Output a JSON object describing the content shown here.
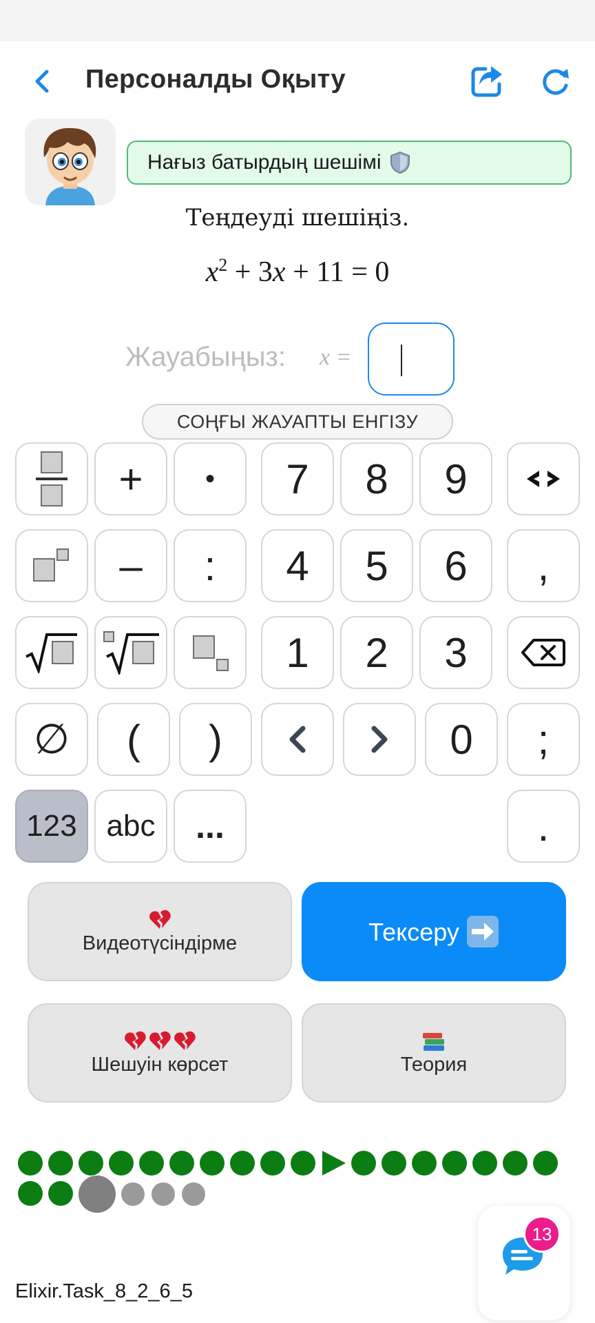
{
  "header": {
    "title": "Персоналды Оқыту",
    "back_icon": "chevron-left-icon",
    "share_icon": "share-icon",
    "refresh_icon": "refresh-icon",
    "accent_color": "#1e88e5"
  },
  "badge": {
    "text": "Нағыз батырдың шешімі",
    "icon": "shield-icon"
  },
  "task": {
    "prompt": "Теңдеуді шешіңіз.",
    "equation": {
      "a": "x",
      "exp": "2",
      "rest": " + 3",
      "b": "x",
      "tail": " + 11 = 0"
    }
  },
  "answer": {
    "label": "Жауабыңыз:",
    "var": "x =",
    "value": ""
  },
  "submit_last_label": "СОҢҒЫ ЖАУАПТЫ ЕНГІЗУ",
  "keypad": {
    "plus": "+",
    "dot": "•",
    "minus": "–",
    "colon": ":",
    "comma": ",",
    "d7": "7",
    "d8": "8",
    "d9": "9",
    "d4": "4",
    "d5": "5",
    "d6": "6",
    "d1": "1",
    "d2": "2",
    "d3": "3",
    "d0": "0",
    "empty_set": "∅",
    "lparen": "(",
    "rparen": ")",
    "semicolon": ";",
    "mode_num": "123",
    "mode_abc": "abc",
    "more": "...",
    "period": "."
  },
  "actions": {
    "video_label": "Видеотүсіндірме",
    "check_label": "Тексеру",
    "solution_label": "Шешуін көрсет",
    "theory_label": "Теория"
  },
  "progress": {
    "completed_color": "#0b7d12",
    "current_color": "#808080",
    "upcoming_color": "#9a9a9a"
  },
  "chat": {
    "badge_count": "13",
    "icon": "chat-icon"
  },
  "task_id": "Elixir.Task_8_2_6_5"
}
